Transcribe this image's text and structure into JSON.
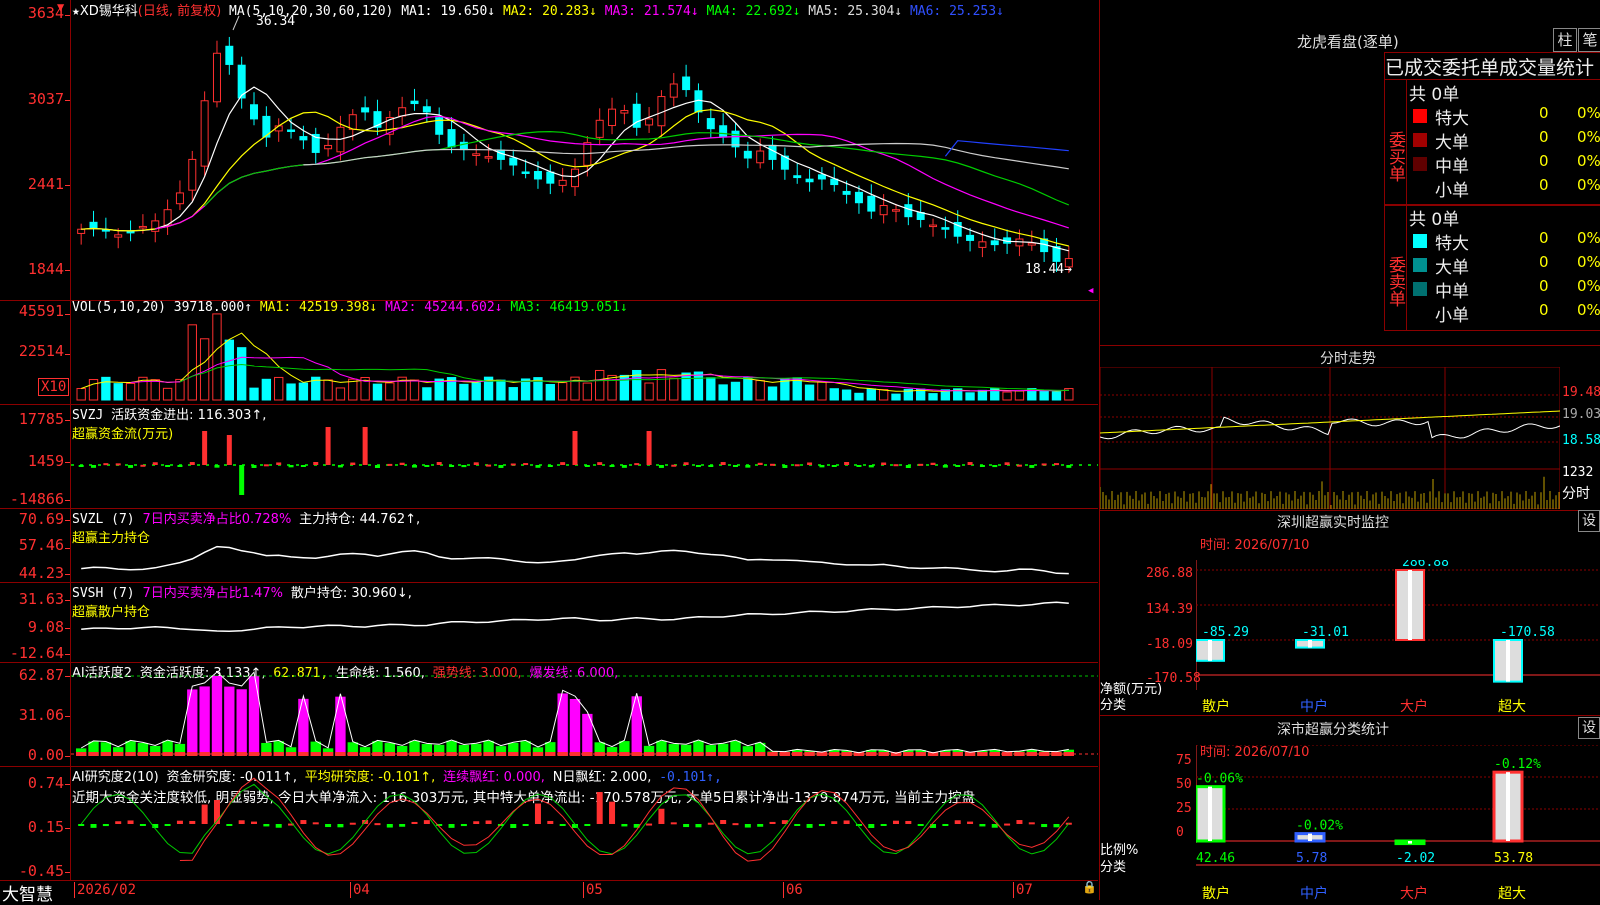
{
  "main_chart": {
    "star": "★",
    "stock_name": "XD锡华科",
    "period": "(日线, 前复权)",
    "ma_legend": "MA(5,10,20,30,60,120)",
    "ma": [
      {
        "label": "MA1: 19.650↓",
        "color": "#ffffff"
      },
      {
        "label": "MA2: 20.283↓",
        "color": "#ffff00"
      },
      {
        "label": "MA3: 21.574↓",
        "color": "#ff00ff"
      },
      {
        "label": "MA4: 22.692↓",
        "color": "#00ff00"
      },
      {
        "label": "MA5: 25.304↓",
        "color": "#dddddd"
      },
      {
        "label": "MA6: 25.253↓",
        "color": "#3050ff"
      }
    ],
    "y_labels": [
      "3634",
      "3037",
      "2441",
      "1844"
    ],
    "high_label": "36.34",
    "low_label": "18.44",
    "low_arrow": "18.44→"
  },
  "vol": {
    "name": "VOL(5,10,20)",
    "value": "39718.000↑",
    "ma1": "MA1: 42519.398↓",
    "ma2": "MA2: 45244.602↓",
    "ma3": "MA3: 46419.051↓",
    "y_labels": [
      "45591",
      "22514"
    ],
    "unit": "X10"
  },
  "svzj": {
    "name": "SVZJ",
    "label": "活跃资金进出: 116.303↑,",
    "sub": "超赢资金流(万元)",
    "y_labels": [
      "17785",
      "1459",
      "-14866"
    ]
  },
  "svzl": {
    "name": "SVZL (7)",
    "pct": "7日内买卖净占比0.728%",
    "hold": "主力持仓: 44.762↑,",
    "sub": "超赢主力持仓",
    "y_labels": [
      "70.69",
      "57.46",
      "44.23"
    ]
  },
  "svsh": {
    "name": "SVSH (7)",
    "pct": "7日内买卖净占比1.47%",
    "hold": "散户持仓: 30.960↓,",
    "sub": "超赢散户持仓",
    "y_labels": [
      "31.63",
      "9.08",
      "-12.64"
    ]
  },
  "ai_active": {
    "name": "AI活跃度2",
    "v1": "资金活跃度: 3.133↑,",
    "v2": "62.871,",
    "v3": "生命线: 1.560,",
    "v4": "强势线: 3.000,",
    "v5": "爆发线: 6.000,",
    "y_labels": [
      "62.87",
      "31.06",
      "0.00"
    ]
  },
  "ai_research": {
    "name": "AI研究度2(10)",
    "v1": "资金研究度: -0.011↑,",
    "v2": "平均研究度: -0.101↑,",
    "v3": "连续飘红: 0.000,",
    "v4": "N日飘红: 2.000,",
    "v5": "-0.101↑,",
    "comment": "近期大资金关注度较低, 明显弱势, 今日大单净流入: 116.303万元, 其中特大单净流出: -170.578万元, 大单5日累计净出-1379.874万元, 当前主力控盘",
    "y_labels": [
      "0.74",
      "0.15",
      "-0.45"
    ]
  },
  "bottom": {
    "brand": "大智慧",
    "dates": [
      "2026/02",
      "04",
      "05",
      "06",
      "07"
    ]
  },
  "lhb": {
    "title": "龙虎看盘(逐单)",
    "btn1": "柱",
    "btn2": "笔",
    "header": "已成交委托单成交量统计",
    "buy_label": "委买单",
    "sell_label": "委卖单",
    "buy_total": "共 0单",
    "sell_total": "共 0单",
    "buy_rows": [
      {
        "name": "特大",
        "count": "0",
        "pct": "0%",
        "color": "#ff0000"
      },
      {
        "name": "大单",
        "count": "0",
        "pct": "0%",
        "color": "#a00000"
      },
      {
        "name": "中单",
        "count": "0",
        "pct": "0%",
        "color": "#600000"
      },
      {
        "name": "小单",
        "count": "0",
        "pct": "0%",
        "color": ""
      }
    ],
    "sell_rows": [
      {
        "name": "特大",
        "count": "0",
        "pct": "0%",
        "color": "#00ffff"
      },
      {
        "name": "大单",
        "count": "0",
        "pct": "0%",
        "color": "#009090"
      },
      {
        "name": "中单",
        "count": "0",
        "pct": "0%",
        "color": "#007070"
      },
      {
        "name": "小单",
        "count": "0",
        "pct": "0%",
        "color": ""
      }
    ]
  },
  "intraday": {
    "title": "分时走势",
    "y_labels": [
      "19.48",
      "19.03",
      "18.58"
    ],
    "vol_label": "1232",
    "time_label": "分时"
  },
  "sz_monitor": {
    "title": "深圳超赢实时监控",
    "btn": "设",
    "time": "时间: 2026/07/10",
    "y_labels": [
      "286.88",
      "134.39",
      "-18.09",
      "-170.58"
    ],
    "axis_title": "净额(万元)",
    "axis_sub": "分类",
    "categories": [
      "散户",
      "中户",
      "大户",
      "超大"
    ],
    "values": [
      -85.29,
      -31.01,
      286.88,
      -170.58
    ],
    "value_labels": [
      "-85.29",
      "-31.01",
      "286.88",
      "-170.58"
    ]
  },
  "sz_stats": {
    "title": "深市超赢分类统计",
    "btn": "设",
    "time": "时间: 2026/07/10",
    "y_labels": [
      "75",
      "50",
      "25",
      "0"
    ],
    "axis_title": "比例%",
    "axis_sub": "分类",
    "categories": [
      "散户",
      "中户",
      "大户",
      "超大"
    ],
    "values": [
      42.46,
      5.78,
      -2.02,
      53.78
    ],
    "value_labels": [
      "42.46",
      "5.78",
      "-2.02",
      "53.78"
    ],
    "change_labels": [
      "-0.06%",
      "-0.02%",
      "",
      "-0.12%"
    ]
  }
}
